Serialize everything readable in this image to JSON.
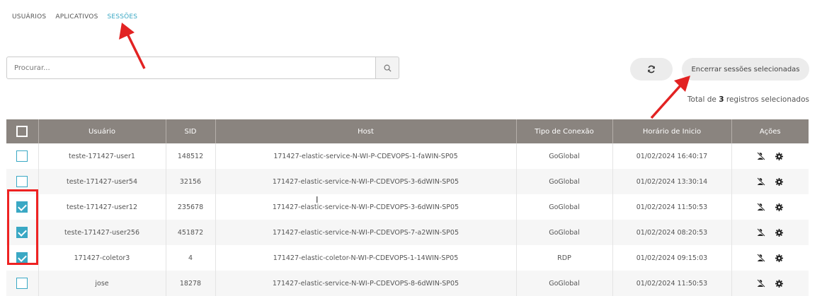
{
  "tabs": [
    {
      "label": "USUÁRIOS",
      "active": false
    },
    {
      "label": "APLICATIVOS",
      "active": false
    },
    {
      "label": "SESSÕES",
      "active": true
    }
  ],
  "search": {
    "placeholder": "Procurar..."
  },
  "toolbar": {
    "end_sessions_label": "Encerrar sessões selecionadas"
  },
  "summary": {
    "prefix": "Total de",
    "count": "3",
    "suffix": "registros selecionados"
  },
  "table": {
    "headers": [
      "Usuário",
      "SID",
      "Host",
      "Tipo de Conexão",
      "Horário de Inicio",
      "Ações"
    ],
    "rows": [
      {
        "checked": false,
        "user": "teste-171427-user1",
        "sid": "148512",
        "host": "171427-elastic-service-N-WI-P-CDEVOPS-1-faWIN-SP05",
        "type": "GoGlobal",
        "start": "01/02/2024 16:40:17"
      },
      {
        "checked": false,
        "user": "teste-171427-user54",
        "sid": "32156",
        "host": "171427-elastic-service-N-WI-P-CDEVOPS-3-6dWIN-SP05",
        "type": "GoGlobal",
        "start": "01/02/2024 13:30:14"
      },
      {
        "checked": true,
        "user": "teste-171427-user12",
        "sid": "235678",
        "host": "171427-elastic-service-N-WI-P-CDEVOPS-3-6dWIN-SP05",
        "type": "GoGlobal",
        "start": "01/02/2024 11:50:53"
      },
      {
        "checked": true,
        "user": "teste-171427-user256",
        "sid": "451872",
        "host": "171427-elastic-service-N-WI-P-CDEVOPS-7-a2WIN-SP05",
        "type": "GoGlobal",
        "start": "01/02/2024 08:20:53"
      },
      {
        "checked": true,
        "user": "171427-coletor3",
        "sid": "4",
        "host": "171427-elastic-coletor-N-WI-P-CDEVOPS-1-14WIN-SP05",
        "type": "RDP",
        "start": "01/02/2024 09:15:03"
      },
      {
        "checked": false,
        "user": "jose",
        "sid": "18278",
        "host": "171427-elastic-service-N-WI-P-CDEVOPS-8-6dWIN-SP05",
        "type": "GoGlobal",
        "start": "01/02/2024 11:50:53"
      }
    ]
  },
  "icons": {
    "search": "search-icon",
    "refresh": "refresh-icon",
    "disconnect": "user-disconnect-icon",
    "settings": "gear-icon"
  },
  "colors": {
    "accent": "#3aa8c4",
    "header_bg": "#8a847f",
    "annotation": "#e22222"
  }
}
